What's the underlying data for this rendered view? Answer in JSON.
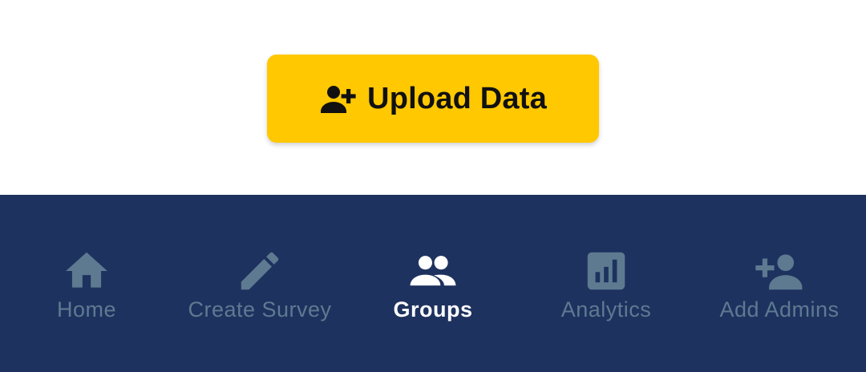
{
  "main": {
    "upload_button": {
      "label": "Upload Data",
      "icon": "person-add-icon",
      "background_color": "#FFC800"
    }
  },
  "bottom_nav": {
    "background_color": "#1E325F",
    "inactive_color": "#5E7A91",
    "active_color": "#FFFFFF",
    "items": [
      {
        "label": "Home",
        "icon": "home-icon",
        "active": false
      },
      {
        "label": "Create Survey",
        "icon": "pencil-icon",
        "active": false
      },
      {
        "label": "Groups",
        "icon": "groups-icon",
        "active": true
      },
      {
        "label": "Analytics",
        "icon": "analytics-icon",
        "active": false
      },
      {
        "label": "Add Admins",
        "icon": "person-add-icon",
        "active": false
      }
    ]
  }
}
